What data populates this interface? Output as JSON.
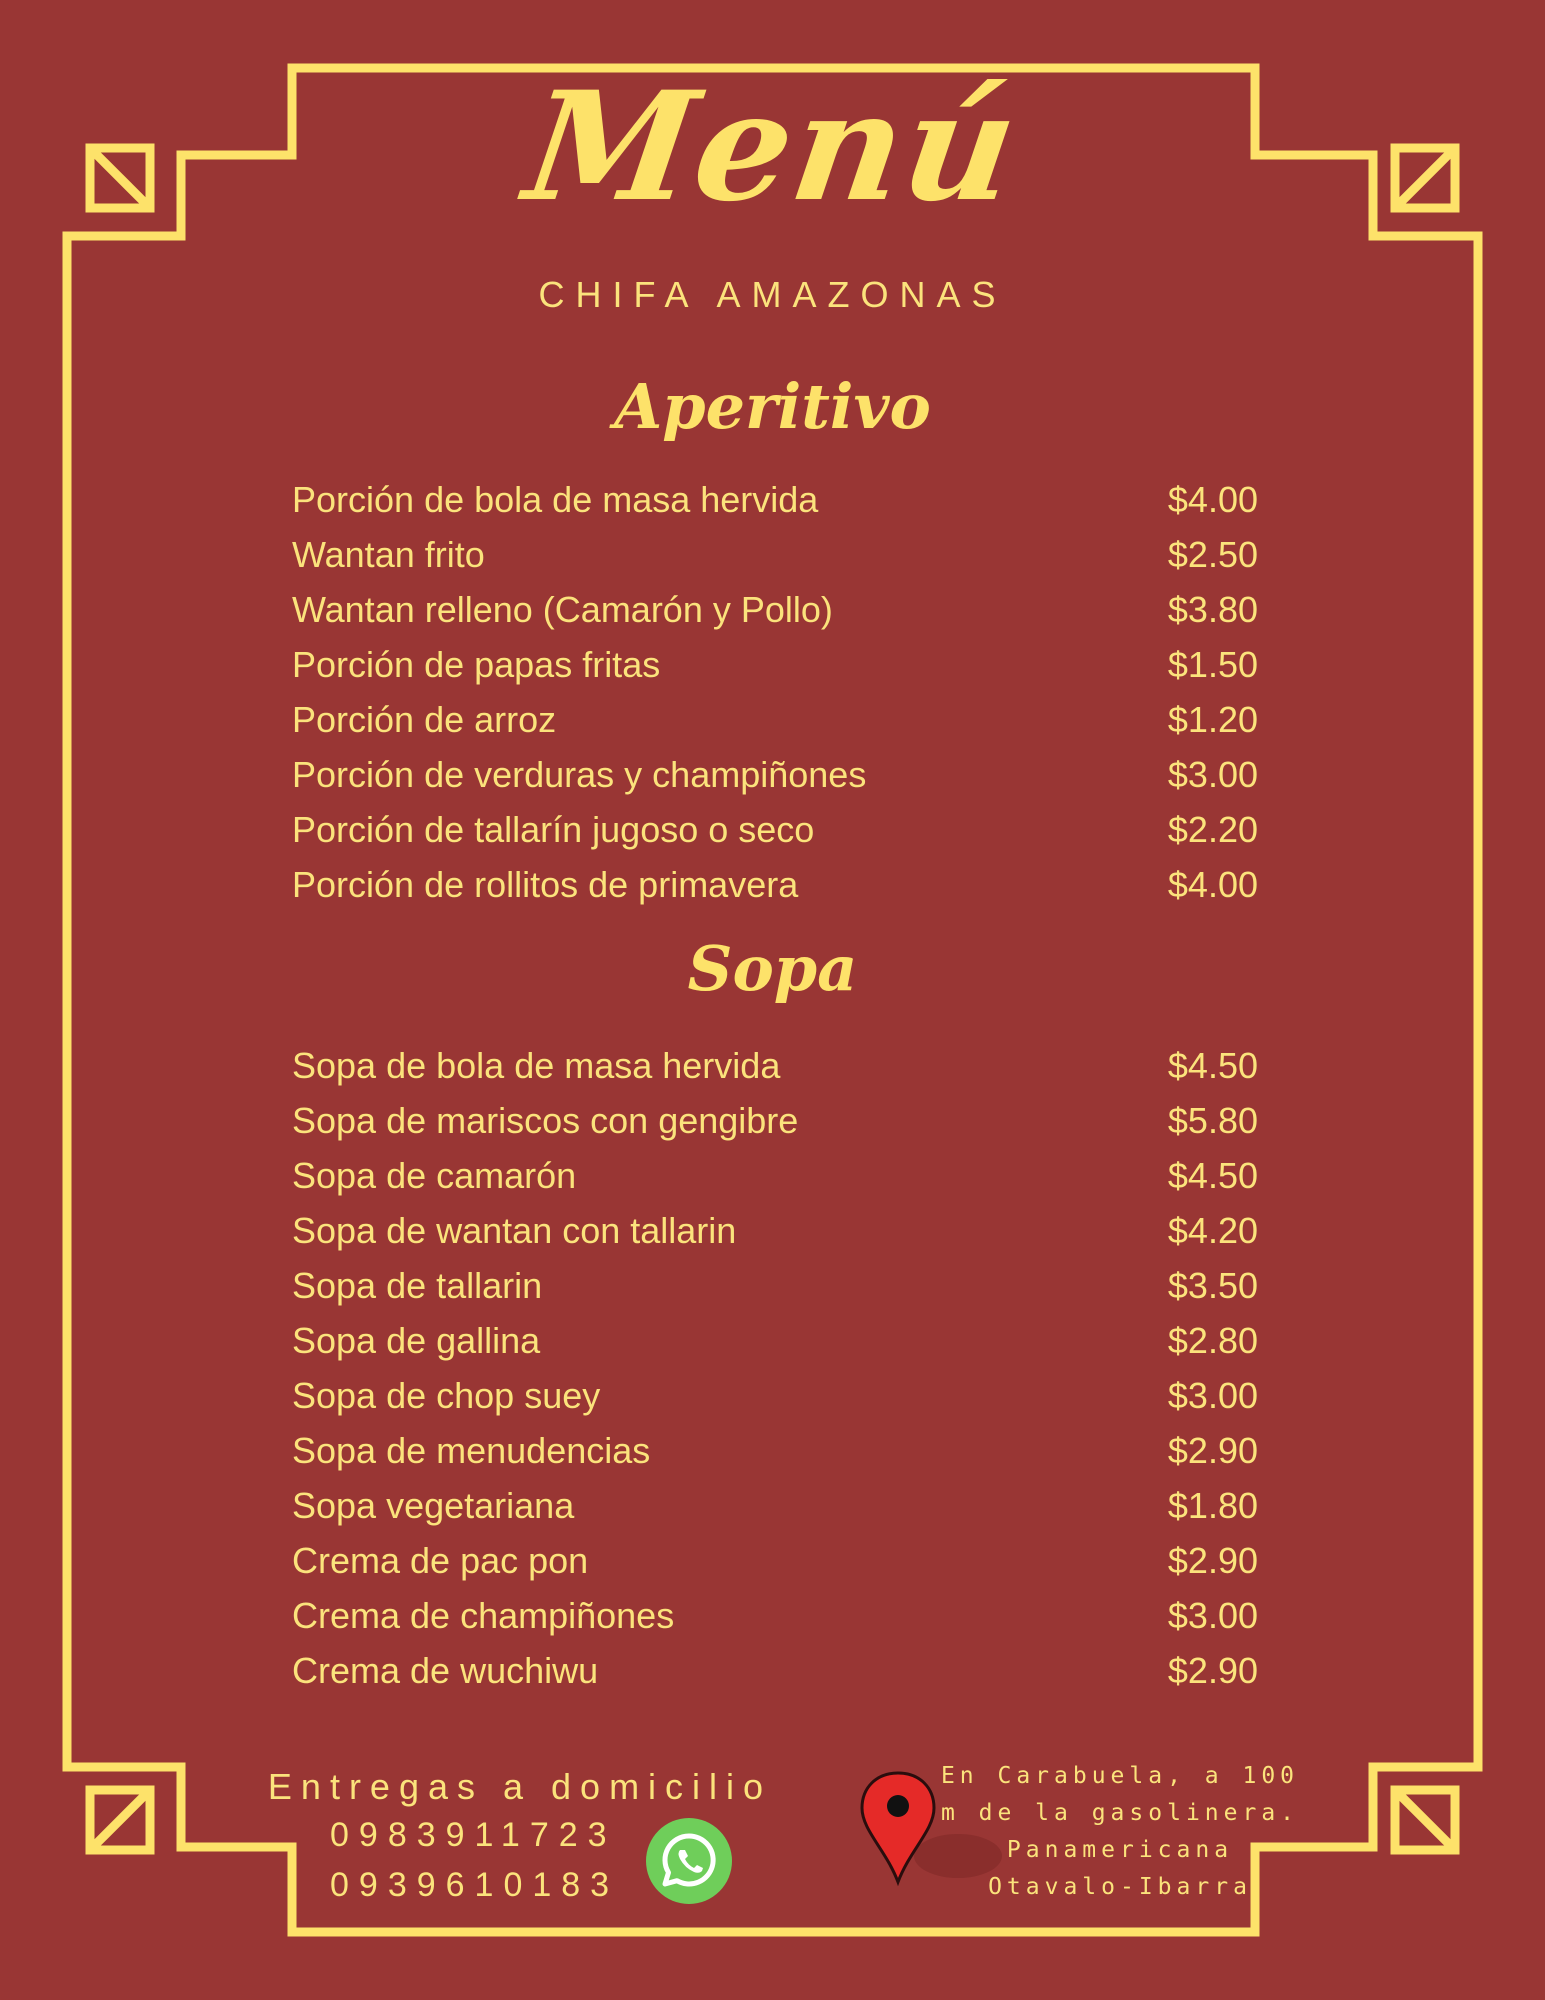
{
  "header": {
    "title": "Menú",
    "subtitle": "CHIFA AMAZONAS"
  },
  "sections": [
    {
      "title": "Aperitivo",
      "items": [
        {
          "name": "Porción de bola de masa hervida",
          "price": "$4.00"
        },
        {
          "name": "Wantan frito",
          "price": "$2.50"
        },
        {
          "name": "Wantan relleno (Camarón y Pollo)",
          "price": "$3.80"
        },
        {
          "name": "Porción de papas fritas",
          "price": "$1.50"
        },
        {
          "name": "Porción de arroz",
          "price": "$1.20"
        },
        {
          "name": "Porción de verduras y champiñones",
          "price": "$3.00"
        },
        {
          "name": "Porción de tallarín jugoso o seco",
          "price": "$2.20"
        },
        {
          "name": "Porción de rollitos de primavera",
          "price": "$4.00"
        }
      ]
    },
    {
      "title": "Sopa",
      "items": [
        {
          "name": "Sopa de bola de masa hervida",
          "price": "$4.50"
        },
        {
          "name": "Sopa de mariscos con gengibre",
          "price": "$5.80"
        },
        {
          "name": "Sopa de camarón",
          "price": "$4.50"
        },
        {
          "name": "Sopa de wantan con tallarin",
          "price": "$4.20"
        },
        {
          "name": "Sopa de tallarin",
          "price": "$3.50"
        },
        {
          "name": "Sopa de gallina",
          "price": "$2.80"
        },
        {
          "name": "Sopa de chop suey",
          "price": "$3.00"
        },
        {
          "name": "Sopa de menudencias",
          "price": "$2.90"
        },
        {
          "name": "Sopa vegetariana",
          "price": "$1.80"
        },
        {
          "name": "Crema de pac pon",
          "price": "$2.90"
        },
        {
          "name": "Crema de champiñones",
          "price": "$3.00"
        },
        {
          "name": "Crema de wuchiwu",
          "price": "$2.90"
        }
      ]
    }
  ],
  "footer": {
    "delivery": "Entregas a domicilio",
    "phones": [
      "0983911723",
      "0939610183"
    ],
    "address_lines": [
      "En Carabuela, a 100",
      "m de la gasolinera.",
      "Panamericana",
      "Otavalo-Ibarra"
    ]
  },
  "icons": {
    "whatsapp": "whatsapp-icon",
    "location": "location-pin-icon"
  },
  "colors": {
    "background": "#993634",
    "gold": "#fde26a",
    "whatsapp_green": "#6fce5a",
    "pin_red": "#e52a28"
  }
}
